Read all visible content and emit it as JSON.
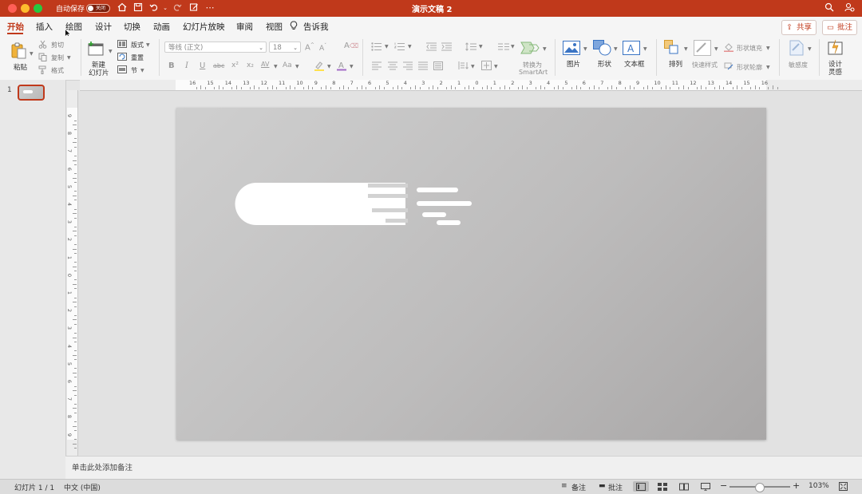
{
  "window": {
    "title": "演示文稿 2"
  },
  "titlebar": {
    "autosave_label": "自动保存",
    "autosave_state": "关闭"
  },
  "tabs": [
    {
      "label": "开始",
      "active": true
    },
    {
      "label": "插入"
    },
    {
      "label": "绘图"
    },
    {
      "label": "设计"
    },
    {
      "label": "切换"
    },
    {
      "label": "动画"
    },
    {
      "label": "幻灯片放映"
    },
    {
      "label": "审阅"
    },
    {
      "label": "视图"
    },
    {
      "label": "告诉我"
    }
  ],
  "header_buttons": {
    "share": "共享",
    "comment": "批注"
  },
  "ribbon": {
    "paste": "粘贴",
    "cut": "剪切",
    "copy": "复制",
    "format": "格式",
    "new_slide_line1": "新建",
    "new_slide_line2": "幻灯片",
    "layout": "版式",
    "reset": "重置",
    "section": "节",
    "font_name": "等线 (正文)",
    "font_size": "18",
    "convert_smartart_line1": "转换为",
    "convert_smartart_line2": "SmartArt",
    "picture": "图片",
    "shape": "形状",
    "textbox": "文本框",
    "arrange": "排列",
    "quick_styles": "快速样式",
    "shape_fill": "形状填充",
    "shape_outline": "形状轮廓",
    "sensitivity": "敏感度",
    "designer_line1": "设计",
    "designer_line2": "灵感",
    "format_buttons": {
      "bold": "B",
      "italic": "I",
      "underline": "U",
      "strike": "abc",
      "superscript": "x²",
      "subscript": "x₂",
      "spacing": "AV",
      "case": "Aa"
    }
  },
  "ruler": {
    "h_labels": [
      "16",
      "15",
      "14",
      "13",
      "12",
      "11",
      "10",
      "9",
      "8",
      "7",
      "6",
      "5",
      "4",
      "3",
      "2",
      "1",
      "0",
      "1",
      "2",
      "3",
      "4",
      "5",
      "6",
      "7",
      "8",
      "9",
      "10",
      "11",
      "12",
      "13",
      "14",
      "15",
      "16"
    ],
    "v_labels": [
      "9",
      "8",
      "7",
      "6",
      "5",
      "4",
      "3",
      "2",
      "1",
      "0",
      "1",
      "2",
      "3",
      "4",
      "5",
      "6",
      "7",
      "8",
      "9"
    ]
  },
  "slide_panel": {
    "slide_number": "1"
  },
  "notes": {
    "placeholder": "单击此处添加备注"
  },
  "statusbar": {
    "slide_info": "幻灯片 1 / 1",
    "language": "中文 (中国)",
    "notes": "备注",
    "comments": "批注",
    "zoom": "103%"
  },
  "colors": {
    "accent": "#c0391b",
    "ribbon_bg": "#f5f5f5"
  }
}
